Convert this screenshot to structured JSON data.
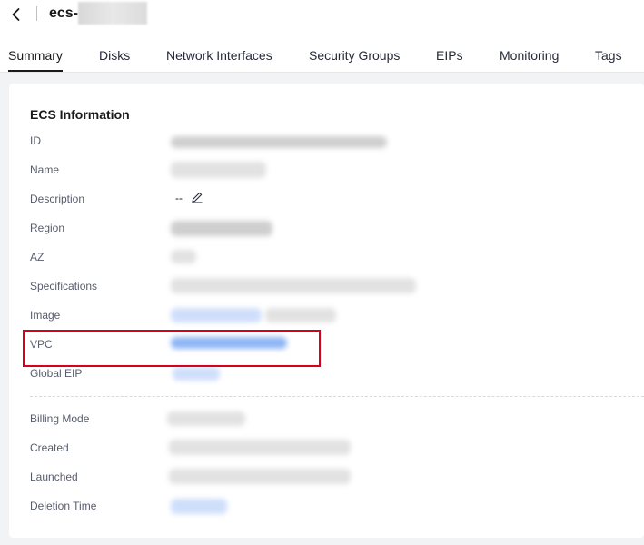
{
  "header": {
    "back_icon": "chevron-left-icon",
    "title": "ecs-"
  },
  "tabs": [
    {
      "label": "Summary",
      "active": true
    },
    {
      "label": "Disks",
      "active": false
    },
    {
      "label": "Network Interfaces",
      "active": false
    },
    {
      "label": "Security Groups",
      "active": false
    },
    {
      "label": "EIPs",
      "active": false
    },
    {
      "label": "Monitoring",
      "active": false
    },
    {
      "label": "Tags",
      "active": false
    }
  ],
  "ecs_info": {
    "title": "ECS Information",
    "labels": {
      "id": "ID",
      "name": "Name",
      "description": "Description",
      "region": "Region",
      "az": "AZ",
      "specifications": "Specifications",
      "image": "Image",
      "vpc": "VPC",
      "global_eip": "Global EIP",
      "billing_mode": "Billing Mode",
      "created": "Created",
      "launched": "Launched",
      "deletion_time": "Deletion Time"
    },
    "description_value": "--",
    "edit_icon": "pencil-icon"
  },
  "colors": {
    "highlight": "#d9001b",
    "link": "#526ecc",
    "panel_bg": "#f2f3f5"
  }
}
